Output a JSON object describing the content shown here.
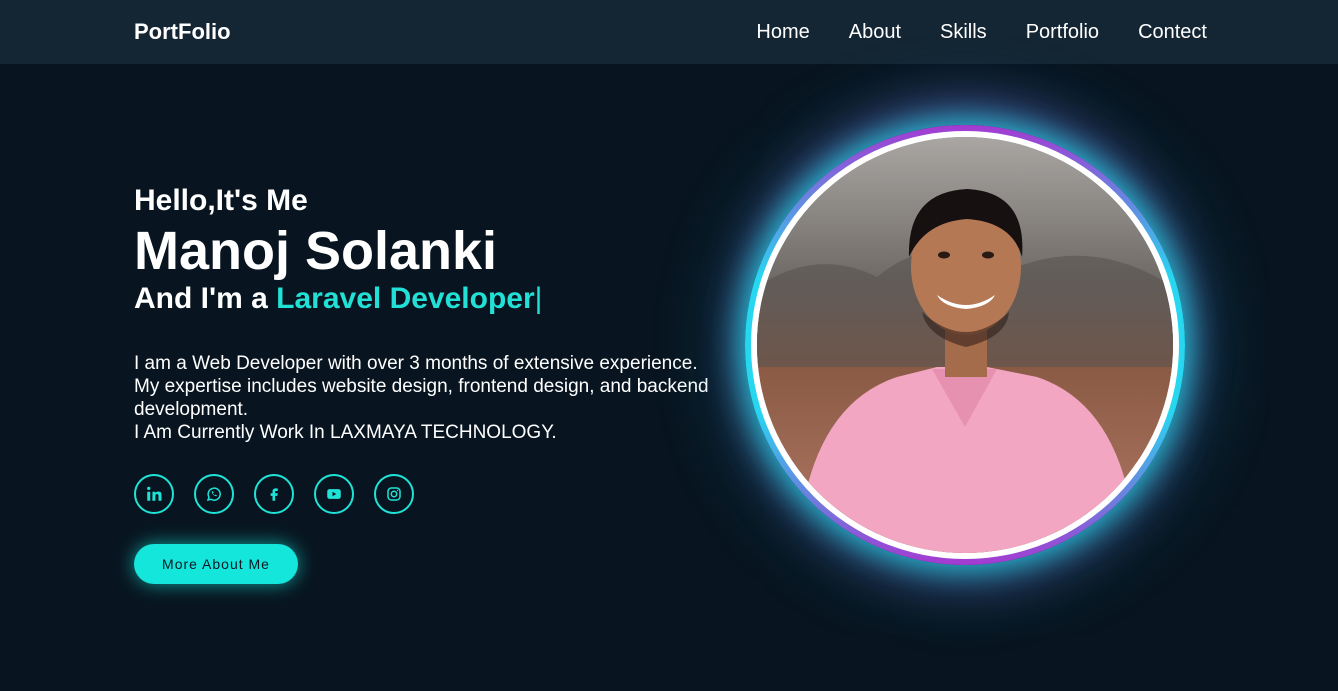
{
  "header": {
    "logo": "PortFolio",
    "nav": [
      "Home",
      "About",
      "Skills",
      "Portfolio",
      "Contect"
    ]
  },
  "hero": {
    "greeting": "Hello,It's Me",
    "name": "Manoj Solanki",
    "role_prefix": "And I'm a ",
    "role_highlight": "Laravel Developer",
    "cursor": "|",
    "description": [
      "I am a Web Developer with over 3 months of extensive experience.",
      "My expertise includes website design, frontend design, and backend development.",
      "I Am Currently Work In LAXMAYA TECHNOLOGY."
    ],
    "socials": [
      "linkedin-icon",
      "whatsapp-icon",
      "facebook-icon",
      "youtube-icon",
      "instagram-icon"
    ],
    "button": "More About Me"
  },
  "colors": {
    "accent": "#15e6dc",
    "ring_purple": "#a43ad1",
    "ring_cyan": "#27d7f0",
    "background": "#081520",
    "navbar": "#142633"
  }
}
